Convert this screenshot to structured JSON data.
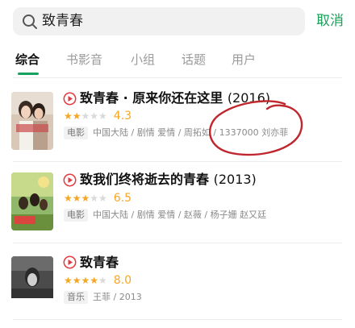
{
  "search": {
    "query": "致青春",
    "cancel_label": "取消"
  },
  "tabs": [
    {
      "label": "综合",
      "active": true
    },
    {
      "label": "书影音",
      "active": false
    },
    {
      "label": "小组",
      "active": false
    },
    {
      "label": "话题",
      "active": false
    },
    {
      "label": "用户",
      "active": false
    }
  ],
  "results": [
    {
      "title": "致青春 · 原来你还在这里",
      "year": "(2016)",
      "rating_stars": 2,
      "score": "4.3",
      "tag": "电影",
      "meta": "中国大陆 / 剧情 爱情 / 周拓如 / 1337000 刘亦菲"
    },
    {
      "title": "致我们终将逝去的青春",
      "year": "(2013)",
      "rating_stars": 3,
      "score": "6.5",
      "tag": "电影",
      "meta": "中国大陆 / 剧情 爱情 / 赵薇 / 杨子姗 赵又廷"
    },
    {
      "title": "致青春",
      "year": "",
      "rating_stars": 4,
      "score": "8.0",
      "tag": "音乐",
      "meta": "王菲 / 2013"
    }
  ],
  "colors": {
    "accent": "#18a058",
    "star": "#f5a623",
    "play": "#e4393c",
    "annotation": "#c0262d"
  },
  "icons": {
    "search": "search-icon",
    "play": "play-icon"
  }
}
